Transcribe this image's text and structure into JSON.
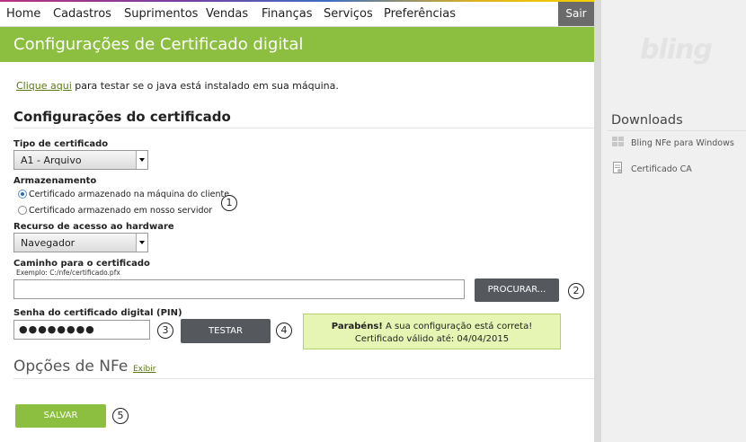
{
  "nav": {
    "items": [
      "Home",
      "Cadastros",
      "Suprimentos",
      "Vendas",
      "Finanças",
      "Serviços",
      "Preferências"
    ],
    "logout": "Sair"
  },
  "page_title": "Configurações de Certificado digital",
  "java_check": {
    "link": "Clique aqui",
    "text": " para testar se o java está instalado em sua máquina."
  },
  "cert_section": {
    "title": "Configurações do certificado",
    "type_label": "Tipo de certificado",
    "type_value": "A1 - Arquivo",
    "storage_label": "Armazenamento",
    "storage_options": [
      "Certificado armazenado na máquina do cliente",
      "Certificado armazenado em nosso servidor"
    ],
    "storage_selected": 0,
    "hardware_label": "Recurso de acesso ao hardware",
    "hardware_value": "Navegador",
    "path_label": "Caminho para o certificado",
    "path_example": "Exemplo: C:/nfe/certificado.pfx",
    "path_value": "",
    "browse_button": "PROCURAR...",
    "pin_label": "Senha do certificado digital (PIN)",
    "pin_value": "●●●●●●●●",
    "test_button": "TESTAR",
    "success_strong": "Parabéns!",
    "success_text": " A sua configuração está correta!",
    "success_validity": "Certificado válido até: 04/04/2015"
  },
  "nfe_options": {
    "title": "Opções de NFe",
    "toggle": "Exibir"
  },
  "save_button": "SALVAR",
  "markers": [
    "1",
    "2",
    "3",
    "4",
    "5"
  ],
  "sidebar": {
    "logo": "bling",
    "downloads_title": "Downloads",
    "items": [
      {
        "label": "Bling NFe para Windows",
        "icon": "windows-icon"
      },
      {
        "label": "Certificado CA",
        "icon": "certificate-icon"
      }
    ]
  },
  "colors": {
    "brand_green": "#8cbf3f",
    "dark_button": "#55595e",
    "success_bg": "#e6f4b4"
  }
}
